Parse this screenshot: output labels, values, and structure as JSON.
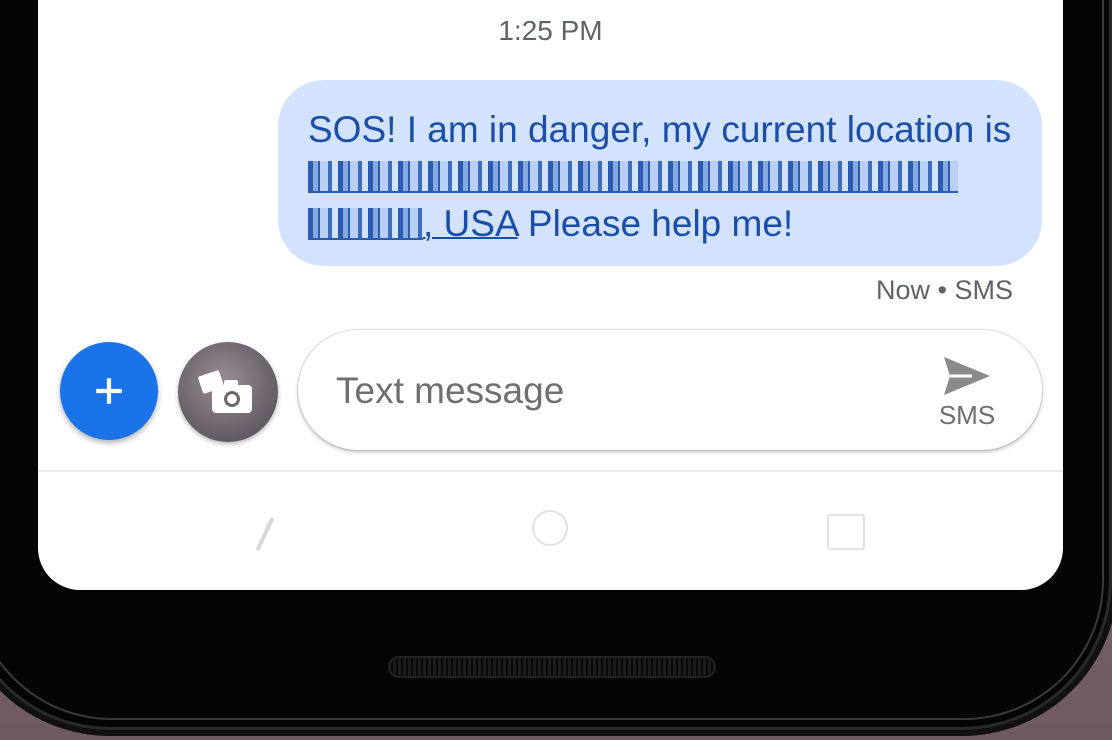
{
  "conversation": {
    "timestamp": "1:25 PM"
  },
  "message": {
    "text_before": "SOS! I am in danger, my current location is ",
    "address_end": ", USA",
    "text_after": " Please help me!",
    "status": "Now • SMS"
  },
  "composer": {
    "placeholder": "Text message",
    "send_label": "SMS"
  },
  "icons": {
    "add": "plus-icon",
    "media": "camera-gallery-icon",
    "send": "send-icon"
  },
  "colors": {
    "bubble": "#d3e3fd",
    "bubble_text": "#1a4ea8",
    "fab": "#1a73e8"
  }
}
